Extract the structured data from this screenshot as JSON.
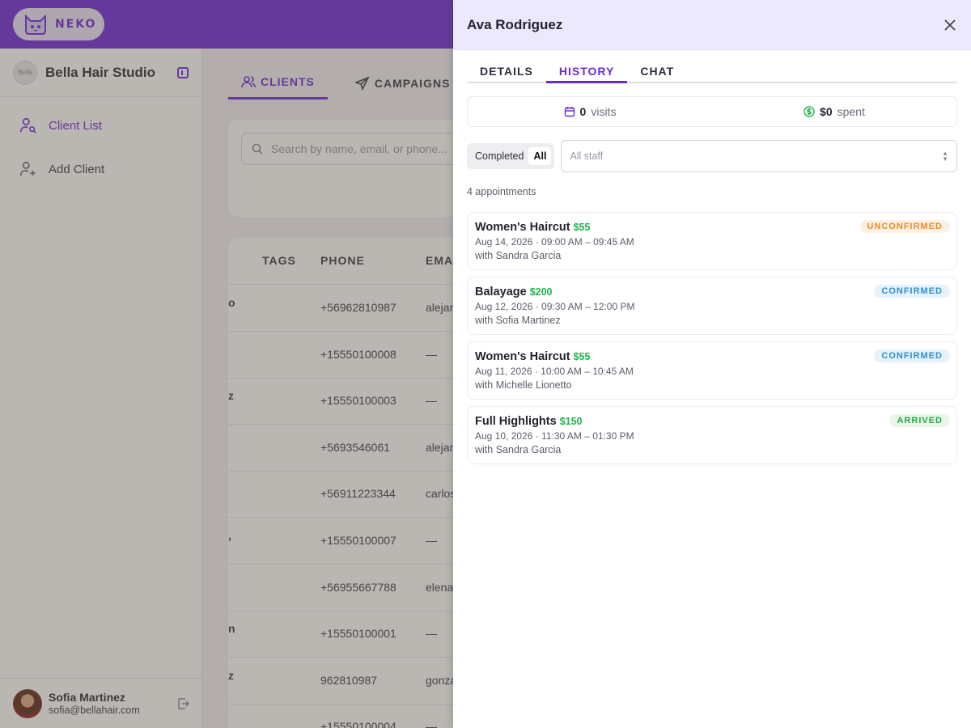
{
  "brand": {
    "name": "NEKO"
  },
  "sidebar": {
    "studio": "Bella Hair Studio",
    "avatar_text": "Bella",
    "items": [
      {
        "label": "Client List",
        "active": true
      },
      {
        "label": "Add Client",
        "active": false
      }
    ],
    "user": {
      "name": "Sofia Martinez",
      "email": "sofia@bellahair.com"
    }
  },
  "main": {
    "tabs": [
      {
        "label": "CLIENTS",
        "active": true
      },
      {
        "label": "CAMPAIGNS",
        "active": false
      }
    ],
    "search_placeholder": "Search by name, email, or phone...",
    "table": {
      "headers": [
        "TAGS",
        "PHONE",
        "EMAIL"
      ],
      "rows": [
        {
          "edge": "o",
          "phone": "+56962810987",
          "email": "alejandro"
        },
        {
          "edge": "",
          "phone": "+15550100008",
          "email": "—"
        },
        {
          "edge": "z",
          "phone": "+15550100003",
          "email": "—"
        },
        {
          "edge": "",
          "phone": "+5693546061",
          "email": "alejandro"
        },
        {
          "edge": "",
          "phone": "+56911223344",
          "email": "carlos"
        },
        {
          "edge": ",",
          "phone": "+15550100007",
          "email": "—"
        },
        {
          "edge": "",
          "phone": "+56955667788",
          "email": "elena"
        },
        {
          "edge": "n",
          "phone": "+15550100001",
          "email": "—"
        },
        {
          "edge": "z",
          "phone": "962810987",
          "email": "gonzalo"
        },
        {
          "edge": "",
          "phone": "+15550100004",
          "email": "—"
        }
      ]
    }
  },
  "drawer": {
    "title": "Ava Rodriguez",
    "tabs": [
      {
        "label": "DETAILS",
        "active": false
      },
      {
        "label": "HISTORY",
        "active": true
      },
      {
        "label": "CHAT",
        "active": false
      }
    ],
    "stats": {
      "visits_value": "0",
      "visits_label": "visits",
      "spent_value": "$0",
      "spent_label": "spent"
    },
    "filter": {
      "segments": [
        {
          "label": "Completed",
          "active": false
        },
        {
          "label": "All",
          "active": true
        }
      ],
      "staff_placeholder": "All staff"
    },
    "count_text": "4 appointments",
    "appointments": [
      {
        "service": "Women's Haircut",
        "price": "$55",
        "time": "Aug 14, 2026 · 09:00 AM – 09:45 AM",
        "staff": "with Sandra Garcia",
        "status": "UNCONFIRMED"
      },
      {
        "service": "Balayage",
        "price": "$200",
        "time": "Aug 12, 2026 · 09:30 AM – 12:00 PM",
        "staff": "with Sofia Martinez",
        "status": "CONFIRMED"
      },
      {
        "service": "Women's Haircut",
        "price": "$55",
        "time": "Aug 11, 2026 · 10:00 AM – 10:45 AM",
        "staff": "with Michelle Lionetto",
        "status": "CONFIRMED"
      },
      {
        "service": "Full Highlights",
        "price": "$150",
        "time": "Aug 10, 2026 · 11:30 AM – 01:30 PM",
        "staff": "with Sandra Garcia",
        "status": "ARRIVED"
      }
    ]
  },
  "colors": {
    "brand": "#6d28d9",
    "price": "#22b34a",
    "unconfirmed": "#f08a24",
    "confirmed": "#2f8fd6",
    "arrived": "#27a844"
  }
}
